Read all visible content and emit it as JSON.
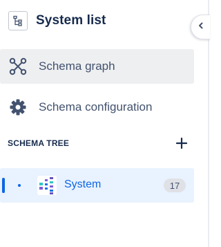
{
  "header": {
    "title": "System list",
    "icon": "hierarchy-icon"
  },
  "collapse": {
    "icon": "chevron-left-icon"
  },
  "nav": {
    "items": [
      {
        "label": "Schema graph",
        "icon": "graph-nodes-icon",
        "active": true
      },
      {
        "label": "Schema configuration",
        "icon": "gear-icon",
        "active": false
      }
    ]
  },
  "schema_tree": {
    "title": "SCHEMA TREE",
    "add_icon": "plus-icon",
    "items": [
      {
        "label": "System",
        "count": "17",
        "icon": "schema-tree-icon",
        "selected": true
      }
    ]
  },
  "colors": {
    "accent": "#0c66e4",
    "selected_bg": "#e9f2ff",
    "active_nav_bg": "#eeeff1",
    "text": "#172b4d",
    "muted_text": "#42526e"
  }
}
